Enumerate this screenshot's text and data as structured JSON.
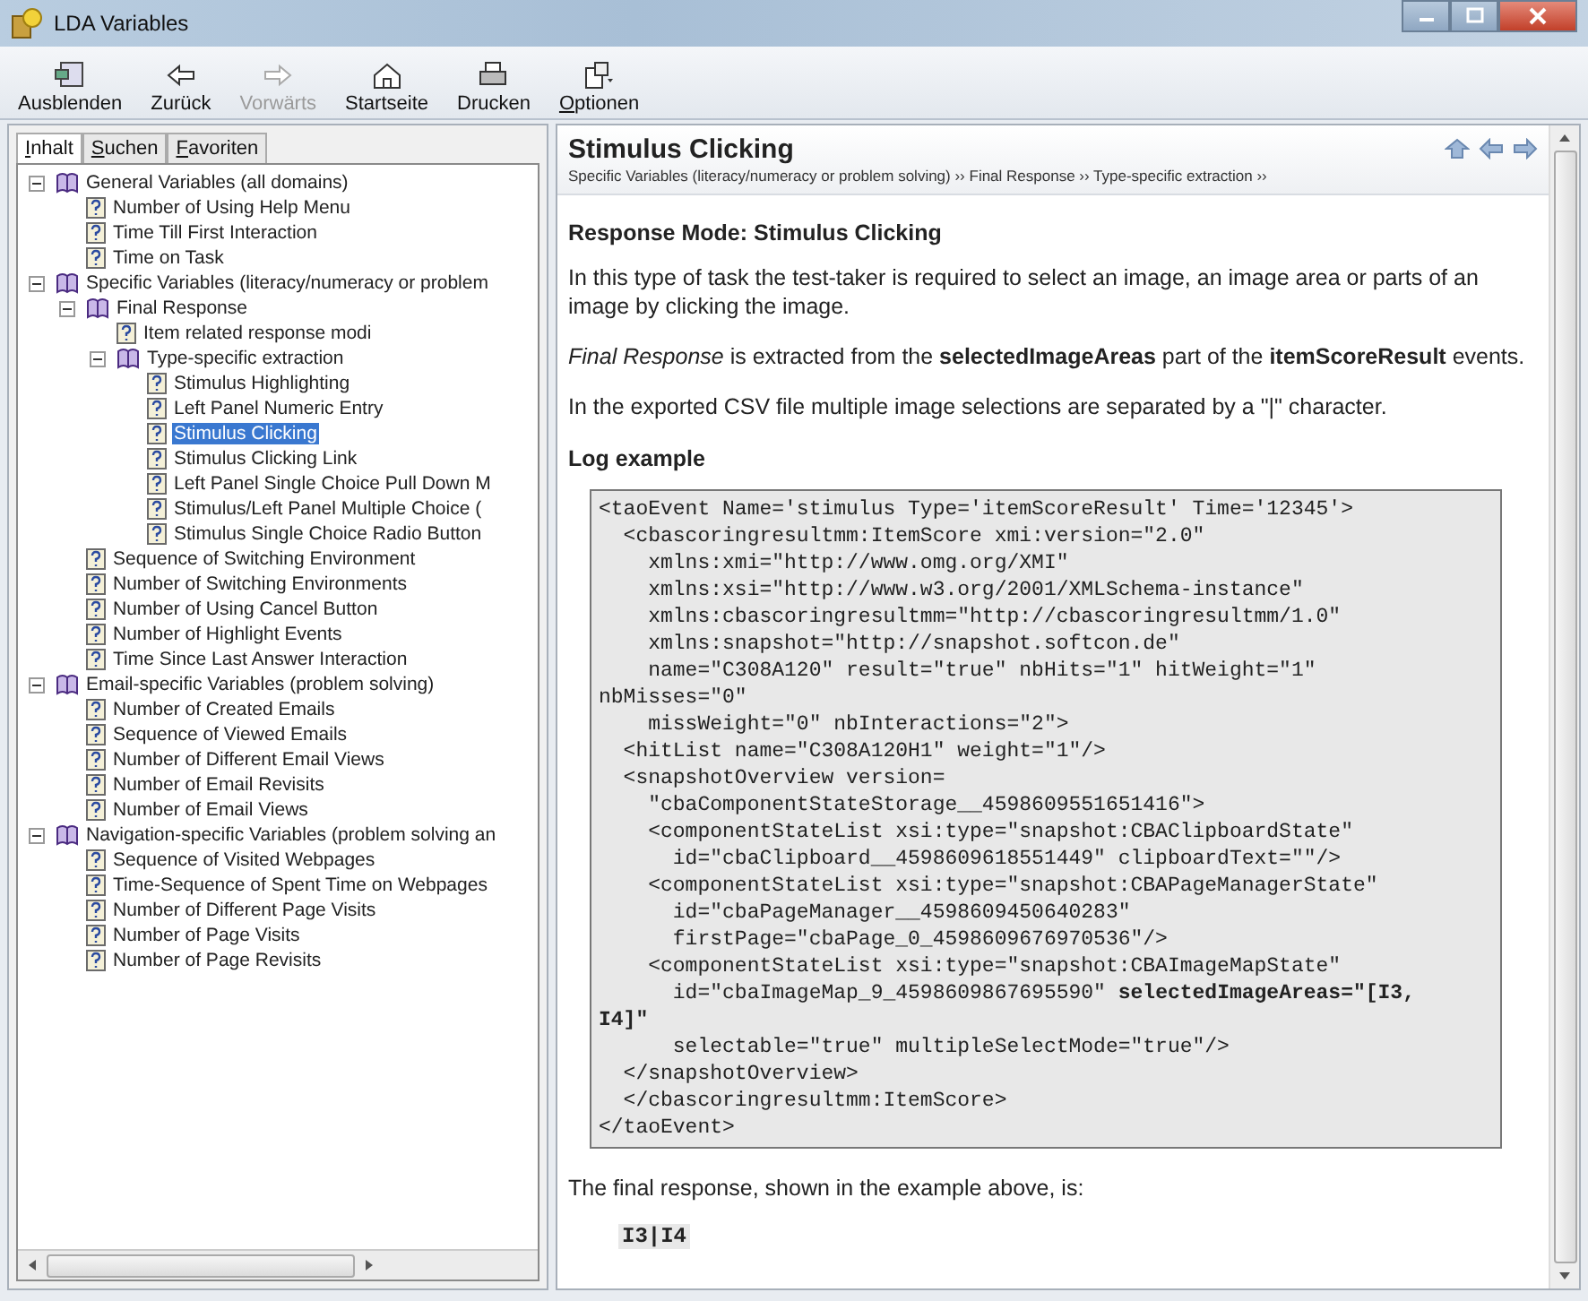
{
  "window": {
    "title": "LDA Variables"
  },
  "toolbar": [
    {
      "kind": "hide",
      "label": "Ausblenden",
      "disabled": false
    },
    {
      "kind": "back",
      "label": "Zurück",
      "disabled": false
    },
    {
      "kind": "forward",
      "label": "Vorwärts",
      "disabled": true
    },
    {
      "kind": "home",
      "label": "Startseite",
      "disabled": false
    },
    {
      "kind": "print",
      "label": "Drucken",
      "disabled": false
    },
    {
      "kind": "options",
      "label": "Optionen",
      "disabled": false
    }
  ],
  "nav_tabs": [
    {
      "label": "Inhalt",
      "selected": true
    },
    {
      "label": "Suchen",
      "selected": false
    },
    {
      "label": "Favoriten",
      "selected": false
    }
  ],
  "tree": [
    {
      "kind": "book",
      "label": "General Variables (all domains)",
      "expanded": true,
      "children": [
        {
          "kind": "page",
          "label": "Number of Using Help Menu",
          "selected": false
        },
        {
          "kind": "page",
          "label": "Time Till First Interaction",
          "selected": false
        },
        {
          "kind": "page",
          "label": "Time on Task",
          "selected": false
        }
      ]
    },
    {
      "kind": "book",
      "label": "Specific Variables (literacy/numeracy or problem",
      "expanded": true,
      "children": [
        {
          "kind": "book",
          "label": "Final Response",
          "expanded": true,
          "children": [
            {
              "kind": "page",
              "label": "Item related response modi",
              "selected": false
            },
            {
              "kind": "book",
              "label": "Type-specific extraction",
              "expanded": true,
              "children": [
                {
                  "kind": "page",
                  "label": "Stimulus Highlighting",
                  "selected": false
                },
                {
                  "kind": "page",
                  "label": "Left Panel Numeric Entry",
                  "selected": false
                },
                {
                  "kind": "page",
                  "label": "Stimulus Clicking",
                  "selected": true
                },
                {
                  "kind": "page",
                  "label": "Stimulus Clicking Link",
                  "selected": false
                },
                {
                  "kind": "page",
                  "label": "Left Panel Single Choice Pull Down M",
                  "selected": false
                },
                {
                  "kind": "page",
                  "label": "Stimulus/Left Panel Multiple Choice (",
                  "selected": false
                },
                {
                  "kind": "page",
                  "label": "Stimulus Single Choice Radio Button",
                  "selected": false
                }
              ]
            }
          ]
        },
        {
          "kind": "page",
          "label": "Sequence of Switching Environment",
          "selected": false
        },
        {
          "kind": "page",
          "label": "Number of Switching Environments",
          "selected": false
        },
        {
          "kind": "page",
          "label": "Number of Using Cancel Button",
          "selected": false
        },
        {
          "kind": "page",
          "label": "Number of Highlight Events",
          "selected": false
        },
        {
          "kind": "page",
          "label": "Time Since Last Answer Interaction",
          "selected": false
        }
      ]
    },
    {
      "kind": "book",
      "label": "Email-specific Variables (problem solving)",
      "expanded": true,
      "children": [
        {
          "kind": "page",
          "label": "Number of Created Emails",
          "selected": false
        },
        {
          "kind": "page",
          "label": "Sequence of Viewed Emails",
          "selected": false
        },
        {
          "kind": "page",
          "label": "Number of Different Email Views",
          "selected": false
        },
        {
          "kind": "page",
          "label": "Number of Email Revisits",
          "selected": false
        },
        {
          "kind": "page",
          "label": "Number of Email Views",
          "selected": false
        }
      ]
    },
    {
      "kind": "book",
      "label": "Navigation-specific Variables (problem solving an",
      "expanded": true,
      "children": [
        {
          "kind": "page",
          "label": "Sequence of Visited Webpages",
          "selected": false
        },
        {
          "kind": "page",
          "label": "Time-Sequence of Spent Time on Webpages",
          "selected": false
        },
        {
          "kind": "page",
          "label": "Number of Different Page Visits",
          "selected": false
        },
        {
          "kind": "page",
          "label": "Number of Page Visits",
          "selected": false
        },
        {
          "kind": "page",
          "label": "Number of Page Revisits",
          "selected": false
        }
      ]
    }
  ],
  "topic": {
    "title": "Stimulus Clicking",
    "breadcrumb": "Specific Variables (literacy/numeracy or problem solving) ›› Final Response ›› Type-specific extraction ››",
    "heading": "Response Mode: Stimulus Clicking",
    "paragraphs": [
      "In this type of task the test-taker is required to select an image, an image area or parts of an image by clicking the image.",
      "*Final Response* is extracted from the **selectedImageAreas** part of the **itemScoreResult** events.",
      "In the exported CSV file multiple image selections are separated by a \"|\" character."
    ],
    "log_heading": "Log example",
    "code_lines": [
      "<taoEvent Name='stimulus Type='itemScoreResult' Time='12345'>",
      "  <cbascoringresultmm:ItemScore xmi:version=\"2.0\"",
      "    xmlns:xmi=\"http://www.omg.org/XMI\"",
      "    xmlns:xsi=\"http://www.w3.org/2001/XMLSchema-instance\"",
      "    xmlns:cbascoringresultmm=\"http://cbascoringresultmm/1.0\"",
      "    xmlns:snapshot=\"http://snapshot.softcon.de\"",
      "    name=\"C308A120\" result=\"true\" nbHits=\"1\" hitWeight=\"1\"",
      "nbMisses=\"0\"",
      "    missWeight=\"0\" nbInteractions=\"2\">",
      "  <hitList name=\"C308A120H1\" weight=\"1\"/>",
      "  <snapshotOverview version=",
      "    \"cbaComponentStateStorage__4598609551651416\">",
      "    <componentStateList xsi:type=\"snapshot:CBAClipboardState\"",
      "      id=\"cbaClipboard__4598609618551449\" clipboardText=\"\"/>",
      "    <componentStateList xsi:type=\"snapshot:CBAPageManagerState\"",
      "      id=\"cbaPageManager__4598609450640283\"",
      "      firstPage=\"cbaPage_0_4598609676970536\"/>",
      "    <componentStateList xsi:type=\"snapshot:CBAImageMapState\"",
      "      id=\"cbaImageMap_9_4598609867695590\" **selectedImageAreas=\"[I3,**",
      "**I4]\"**",
      "      selectable=\"true\" multipleSelectMode=\"true\"/>",
      "  </snapshotOverview>",
      "  </cbascoringresultmm:ItemScore>",
      "</taoEvent>"
    ],
    "result_intro": "The final response, shown in the example above, is:",
    "result": "I3|I4"
  }
}
